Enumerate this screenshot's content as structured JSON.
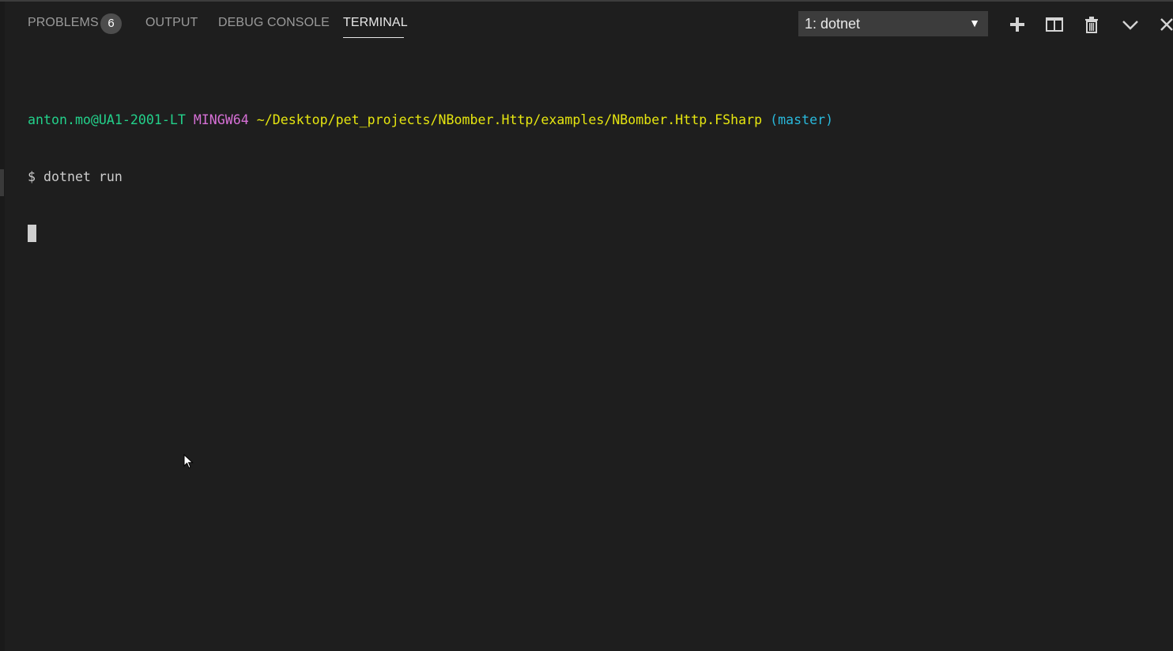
{
  "tabs": [
    {
      "label": "PROBLEMS",
      "badge": "6",
      "active": false
    },
    {
      "label": "OUTPUT",
      "active": false
    },
    {
      "label": "DEBUG CONSOLE",
      "active": false
    },
    {
      "label": "TERMINAL",
      "active": true
    }
  ],
  "terminal_select": {
    "value": "1: dotnet"
  },
  "toolbar_icons": [
    "plus-icon",
    "split-icon",
    "trash-icon",
    "chevron-down-icon",
    "close-icon"
  ],
  "terminal": {
    "prompt_user": "anton.mo@UA1-2001-LT",
    "prompt_env": "MINGW64",
    "prompt_path": "~/Desktop/pet_projects/NBomber.Http/examples/NBomber.Http.FSharp",
    "prompt_branch": "(master)",
    "command": "$ dotnet run"
  },
  "colors": {
    "background": "#1e1e1e",
    "user": "#23d18b",
    "env": "#d670d6",
    "path": "#e5e510",
    "branch": "#29b8db"
  }
}
